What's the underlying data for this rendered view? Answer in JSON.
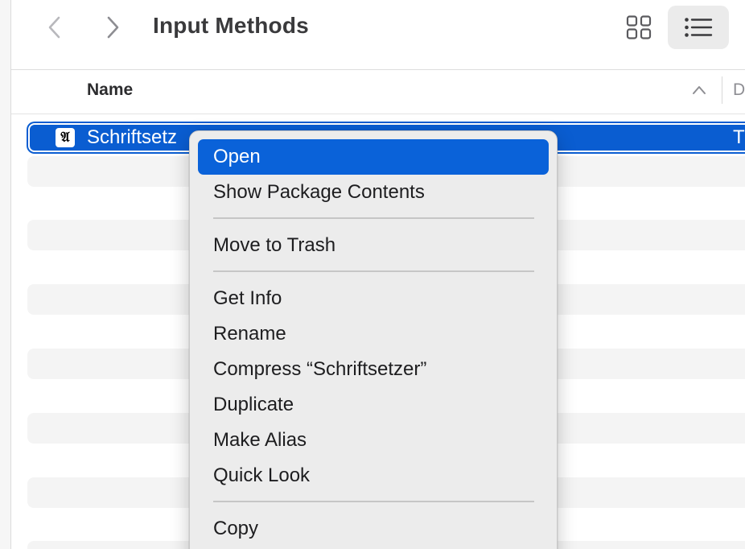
{
  "toolbar": {
    "title": "Input Methods",
    "back_icon": "chevron-left-icon",
    "forward_icon": "chevron-right-icon",
    "grid_view_icon": "grid-view-icon",
    "list_view_icon": "list-view-icon"
  },
  "columns": {
    "name_header": "Name",
    "sort_icon": "chevron-up-icon",
    "next_header_partial": "D"
  },
  "files": [
    {
      "name": "Schriftsetz",
      "icon_glyph": "𝔄",
      "kind_partial": "T",
      "selected": true
    }
  ],
  "context_menu": {
    "items": [
      {
        "label": "Open",
        "highlighted": true
      },
      {
        "label": "Show Package Contents"
      },
      {
        "label": "Move to Trash"
      },
      {
        "label": "Get Info"
      },
      {
        "label": "Rename"
      },
      {
        "label": "Compress “Schriftsetzer”"
      },
      {
        "label": "Duplicate"
      },
      {
        "label": "Make Alias"
      },
      {
        "label": "Quick Look"
      },
      {
        "label": "Copy"
      }
    ]
  },
  "colors": {
    "selection": "#0a5dd1",
    "menu_highlight": "#0a62d9",
    "menu_background": "#ececec",
    "stripe": "#f4f4f4"
  }
}
